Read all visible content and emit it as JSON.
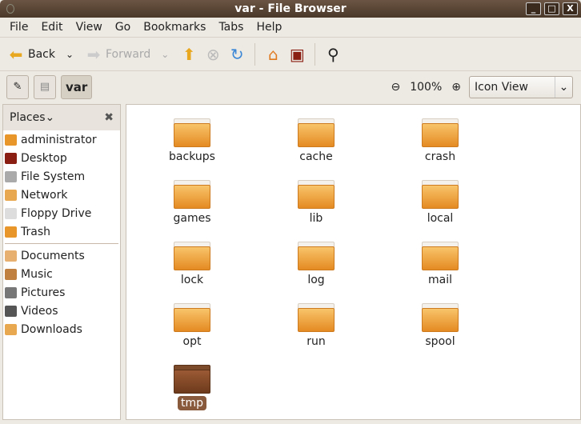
{
  "window": {
    "title": "var - File Browser",
    "minimize": "_",
    "maximize": "□",
    "close": "X"
  },
  "menu": [
    "File",
    "Edit",
    "View",
    "Go",
    "Bookmarks",
    "Tabs",
    "Help"
  ],
  "toolbar": {
    "back": "Back",
    "forward": "Forward"
  },
  "location": {
    "current": "var",
    "zoom": "100%",
    "view_mode": "Icon View"
  },
  "sidebar": {
    "title": "Places",
    "groups": [
      [
        "administrator",
        "Desktop",
        "File System",
        "Network",
        "Floppy Drive",
        "Trash"
      ],
      [
        "Documents",
        "Music",
        "Pictures",
        "Videos",
        "Downloads"
      ]
    ]
  },
  "files": [
    "backups",
    "cache",
    "crash",
    "games",
    "lib",
    "local",
    "lock",
    "log",
    "mail",
    "opt",
    "run",
    "spool",
    "tmp"
  ],
  "selected": "tmp"
}
